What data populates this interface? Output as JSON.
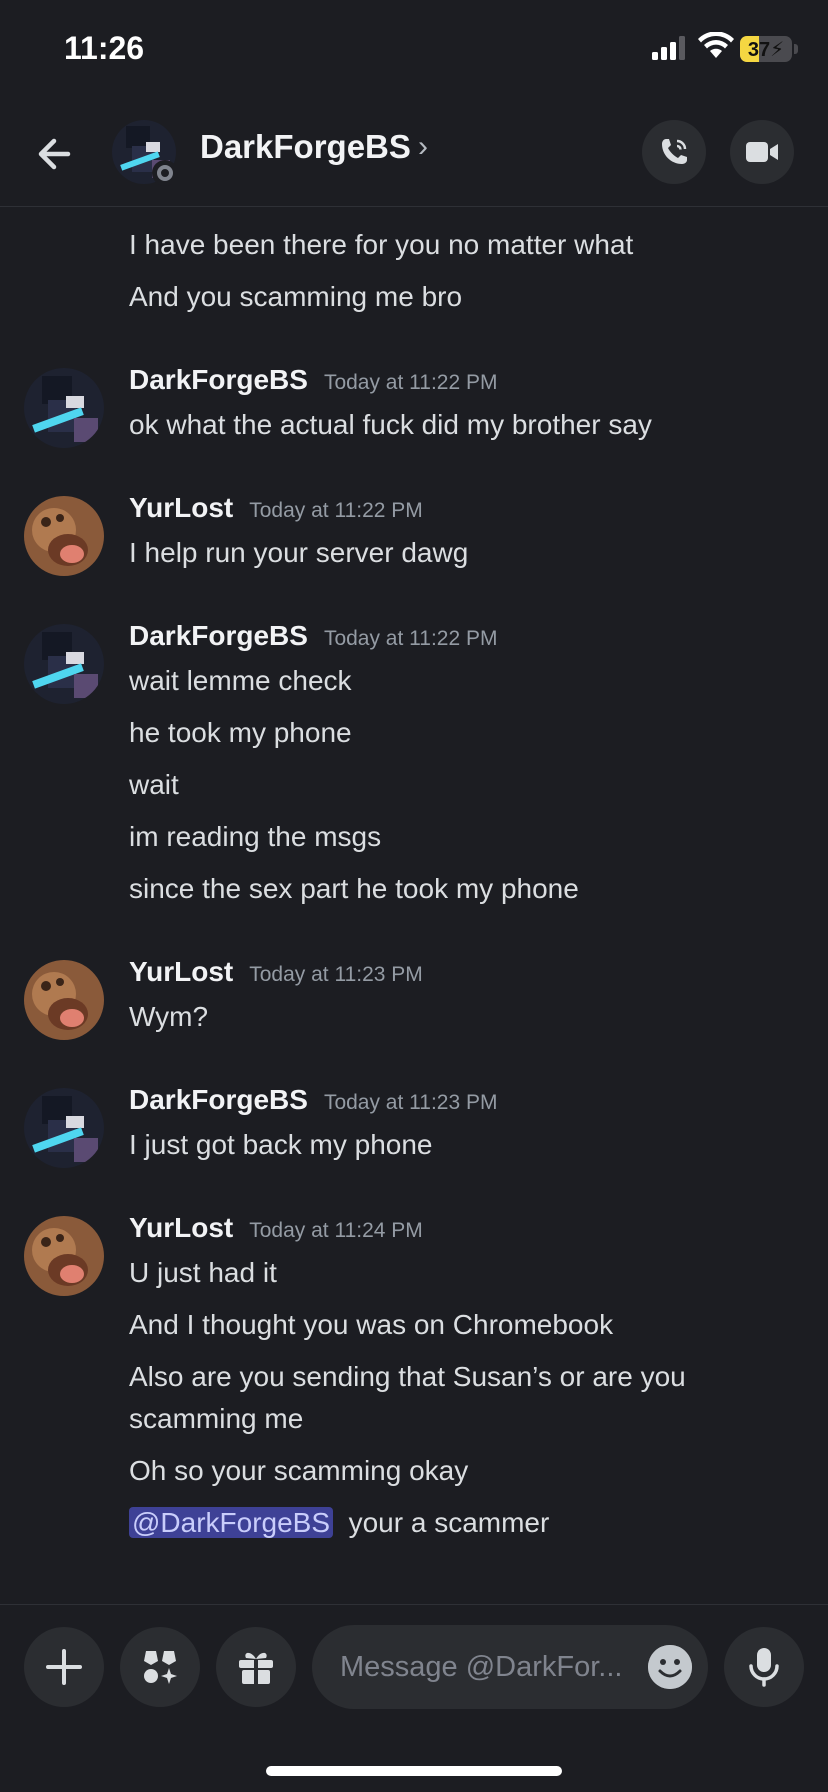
{
  "status_bar": {
    "time": "11:26",
    "battery": "37",
    "battery_level": 0.37
  },
  "header": {
    "title": "DarkForgeBS",
    "chevron": "›"
  },
  "messages": {
    "continuation": [
      "I have been there for you no matter what",
      "And you scamming me bro"
    ],
    "groups": [
      {
        "author": "DarkForgeBS",
        "timestamp": "Today at 11:22 PM",
        "lines": [
          "ok what the actual fuck did my brother say"
        ]
      },
      {
        "author": "YurLost",
        "timestamp": "Today at 11:22 PM",
        "lines": [
          "I help run your server dawg"
        ]
      },
      {
        "author": "DarkForgeBS",
        "timestamp": "Today at 11:22 PM",
        "lines": [
          "wait lemme check",
          "he took my phone",
          "wait",
          "im reading the msgs",
          "since the sex part he took my phone"
        ]
      },
      {
        "author": "YurLost",
        "timestamp": "Today at 11:23 PM",
        "lines": [
          "Wym?"
        ]
      },
      {
        "author": "DarkForgeBS",
        "timestamp": "Today at 11:23 PM",
        "lines": [
          "I just got back my phone"
        ]
      },
      {
        "author": "YurLost",
        "timestamp": "Today at 11:24 PM",
        "lines": [
          "U just had it",
          "And I thought you was on Chromebook",
          "Also are you sending that Susan’s or are you scamming me",
          "Oh so your scamming okay"
        ],
        "mention": "@DarkForgeBS",
        "mention_text": "your a scammer"
      }
    ]
  },
  "composer": {
    "placeholder": "Message @DarkFor..."
  },
  "colors": {
    "background": "#1c1d22",
    "surface": "#2b2d31",
    "mention_bg": "#3e4196",
    "text": "#dbdee1"
  },
  "icons": [
    "back-arrow-icon",
    "phone-call-icon",
    "video-camera-icon",
    "plus-icon",
    "apps-icon",
    "gift-icon",
    "emoji-icon",
    "microphone-icon"
  ]
}
